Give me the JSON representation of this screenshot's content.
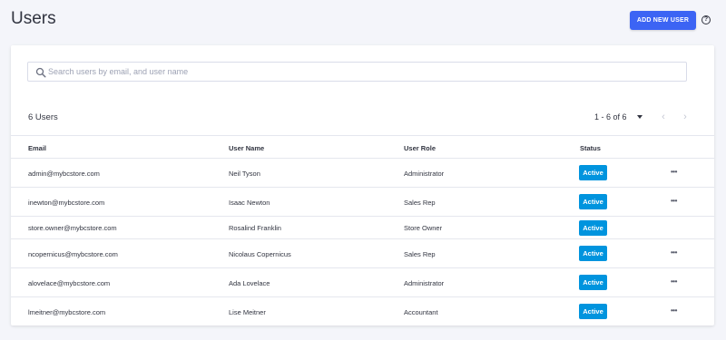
{
  "page": {
    "title": "Users",
    "add_button": "ADD NEW USER",
    "help": "?"
  },
  "search": {
    "placeholder": "Search users by email, and user name"
  },
  "summary": {
    "count": "6 Users",
    "range": "1 - 6 of 6",
    "prev": "‹",
    "next": "›"
  },
  "table": {
    "headers": [
      "Email",
      "User Name",
      "User Role",
      "Status"
    ],
    "rows": [
      {
        "email": "admin@mybcstore.com",
        "name": "Neil Tyson",
        "role": "Administrator",
        "status": "Active",
        "actions": "•••"
      },
      {
        "email": "inewton@mybcstore.com",
        "name": "Isaac Newton",
        "role": "Sales Rep",
        "status": "Active",
        "actions": "•••"
      },
      {
        "email": "store.owner@mybcstore.com",
        "name": "Rosalind Franklin",
        "role": "Store Owner",
        "status": "Active",
        "actions": ""
      },
      {
        "email": "ncopernicus@mybcstore.com",
        "name": "Nicolaus Copernicus",
        "role": "Sales Rep",
        "status": "Active",
        "actions": "•••"
      },
      {
        "email": "alovelace@mybcstore.com",
        "name": "Ada Lovelace",
        "role": "Administrator",
        "status": "Active",
        "actions": "•••"
      },
      {
        "email": "lmeitner@mybcstore.com",
        "name": "Lise Meitner",
        "role": "Accountant",
        "status": "Active",
        "actions": "•••"
      }
    ]
  },
  "colors": {
    "accent": "#3c64f4",
    "status_active": "#0094de",
    "background": "#f4f5fa"
  }
}
